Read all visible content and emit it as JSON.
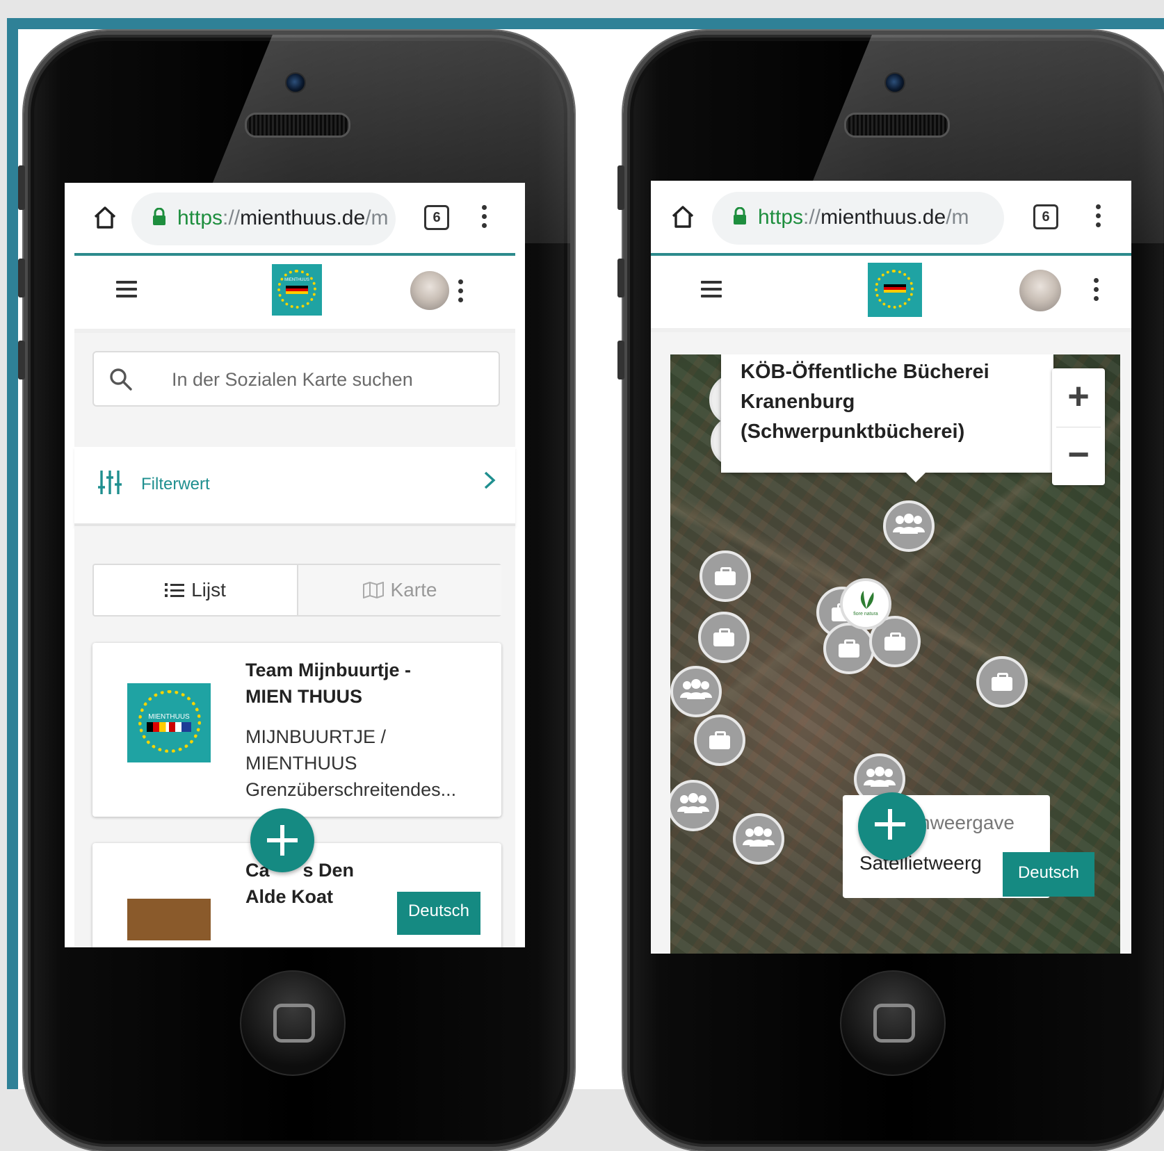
{
  "colors": {
    "frame": "#2f8197",
    "accent": "#158a82",
    "link_green": "#1e8e3e"
  },
  "browser": {
    "url_scheme": "https",
    "url_sep": "://",
    "url_host": "mienthuus.de",
    "url_path": "/m",
    "tab_count": "6"
  },
  "left_screen": {
    "search_placeholder": "In der Sozialen Karte suchen",
    "filter_label": "Filterwert",
    "view_toggle": {
      "list": "Lijst",
      "map": "Karte"
    },
    "cards": [
      {
        "title_line1": "Team Mijnbuurtje -",
        "title_line2": "MIEN THUUS",
        "desc_line1": "MIJNBUURTJE /",
        "desc_line2": "MIENTHUUS",
        "desc_line3": "Grenzüberschreitendes..."
      },
      {
        "title_line1_a": "Ca",
        "title_line1_b": "s Den",
        "title_line2": "Alde Koat"
      }
    ],
    "logo_text": "MIENTHUUS",
    "language_button": "Deutsch"
  },
  "right_screen": {
    "popup": {
      "line1": "KÖB-Öffentliche Bücherei",
      "line2": "Kranenburg",
      "line3": "(Schwerpunktbücherei)"
    },
    "zoom_in": "+",
    "zoom_out": "−",
    "layers": {
      "option1_partial": "nweergave",
      "option2_partial": "Satellietweerg"
    },
    "plant_marker_label": "fiore natura",
    "language_button": "Deutsch"
  }
}
